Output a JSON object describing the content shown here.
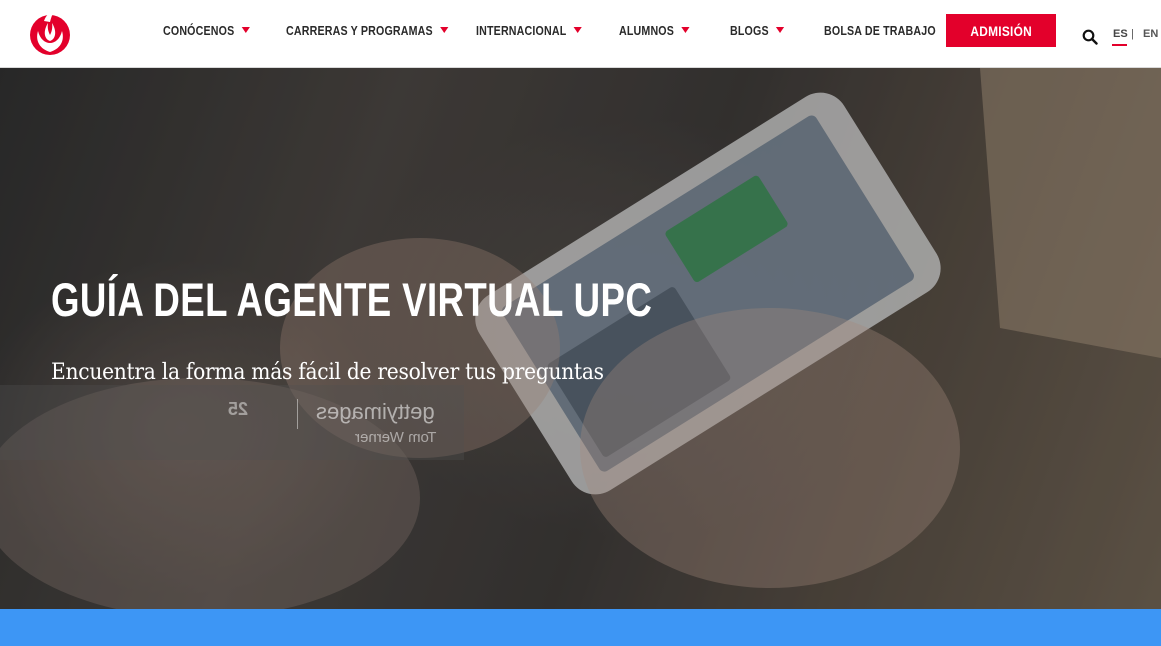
{
  "header": {
    "logo_icon": "upc-logo-icon",
    "nav": [
      {
        "label": "CONÓCENOS",
        "has_dropdown": true
      },
      {
        "label": "CARRERAS Y PROGRAMAS",
        "has_dropdown": true
      },
      {
        "label": "INTERNACIONAL",
        "has_dropdown": true
      },
      {
        "label": "ALUMNOS",
        "has_dropdown": true
      },
      {
        "label": "BLOGS",
        "has_dropdown": true
      },
      {
        "label": "BOLSA DE TRABAJO",
        "has_dropdown": false
      }
    ],
    "cta_label": "ADMISIÓN",
    "search_icon": "search-icon",
    "lang": {
      "active": "ES",
      "separator": "|",
      "other": "EN"
    }
  },
  "hero": {
    "title": "GUÍA DEL AGENTE VIRTUAL UPC",
    "subtitle": "Encuentra la forma más fácil de resolver tus preguntas",
    "watermark": {
      "brand": "gettyimages",
      "author": "Tom Werner",
      "badge": "25"
    }
  },
  "colors": {
    "brand_red": "#e3002b",
    "band_blue": "#3d96f5"
  }
}
